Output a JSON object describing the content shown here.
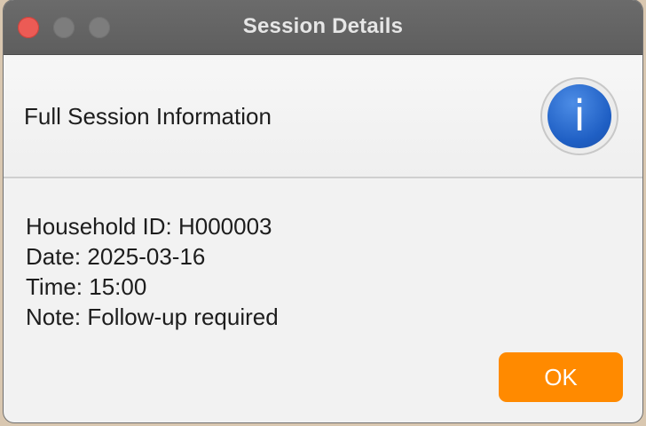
{
  "window": {
    "title": "Session Details"
  },
  "header": {
    "title": "Full Session Information",
    "icon": "info-icon"
  },
  "details": {
    "household_id": "Household ID: H000003",
    "date": "Date: 2025-03-16",
    "time": "Time: 15:00",
    "note": "Note: Follow-up required"
  },
  "buttons": {
    "ok_label": "OK"
  },
  "colors": {
    "accent": "#ff8a00",
    "info_blue": "#1f5fc4",
    "close_red": "#ec5b55"
  }
}
